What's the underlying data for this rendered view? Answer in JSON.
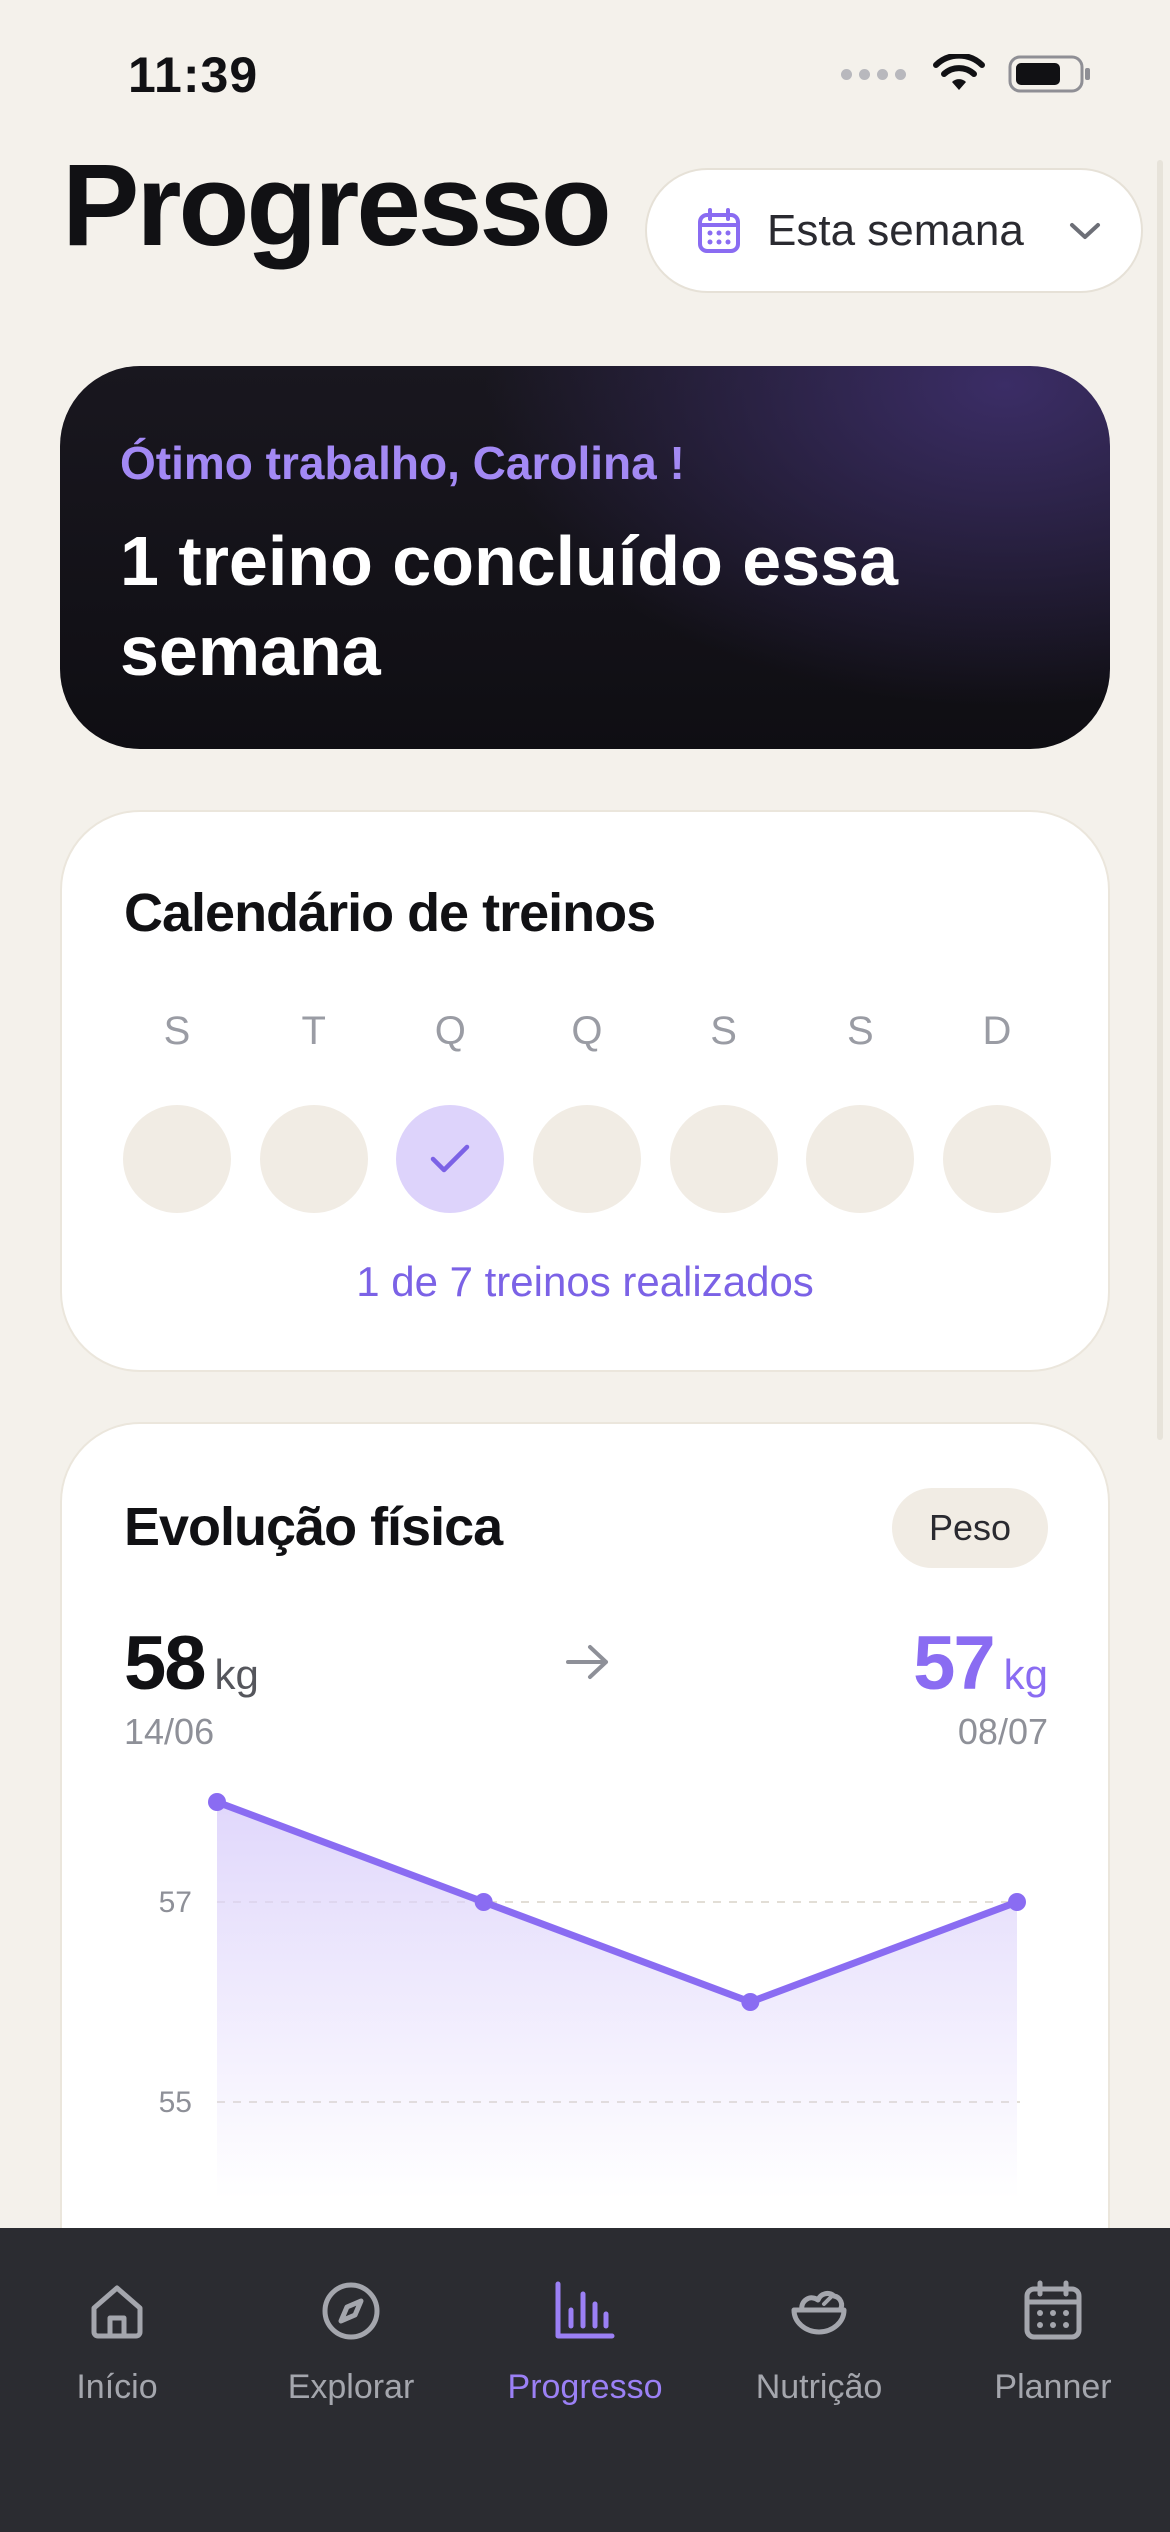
{
  "status": {
    "time": "11:39"
  },
  "header": {
    "title": "Progresso",
    "period_label": "Esta semana"
  },
  "hero": {
    "greeting": "Ótimo trabalho, Carolina !",
    "title": "1 treino concluído essa semana"
  },
  "calendar": {
    "title": "Calendário de treinos",
    "days": [
      {
        "letter": "S",
        "done": false
      },
      {
        "letter": "T",
        "done": false
      },
      {
        "letter": "Q",
        "done": true
      },
      {
        "letter": "Q",
        "done": false
      },
      {
        "letter": "S",
        "done": false
      },
      {
        "letter": "S",
        "done": false
      },
      {
        "letter": "D",
        "done": false
      }
    ],
    "summary": "1 de 7 treinos realizados"
  },
  "evolution": {
    "title": "Evolução física",
    "metric_label": "Peso",
    "start": {
      "value": "58",
      "unit": "kg",
      "date": "14/06"
    },
    "end": {
      "value": "57",
      "unit": "kg",
      "date": "08/07"
    }
  },
  "chart_data": {
    "type": "area",
    "y_ticks": [
      59,
      57,
      55
    ],
    "ylim": [
      55,
      59
    ],
    "values": [
      58,
      57,
      56,
      57
    ],
    "grid": true,
    "colors": {
      "line": "#8a6cf2",
      "fill": "#ddd3fb"
    }
  },
  "tabs": [
    {
      "label": "Início",
      "icon": "home-icon",
      "active": false
    },
    {
      "label": "Explorar",
      "icon": "compass-icon",
      "active": false
    },
    {
      "label": "Progresso",
      "icon": "bar-chart-icon",
      "active": true
    },
    {
      "label": "Nutrição",
      "icon": "salad-bowl-icon",
      "active": false
    },
    {
      "label": "Planner",
      "icon": "calendar-icon",
      "active": false
    }
  ],
  "colors": {
    "accent": "#8a6cf2",
    "background": "#f4f1eb",
    "tab_bar": "#2b2c31"
  }
}
